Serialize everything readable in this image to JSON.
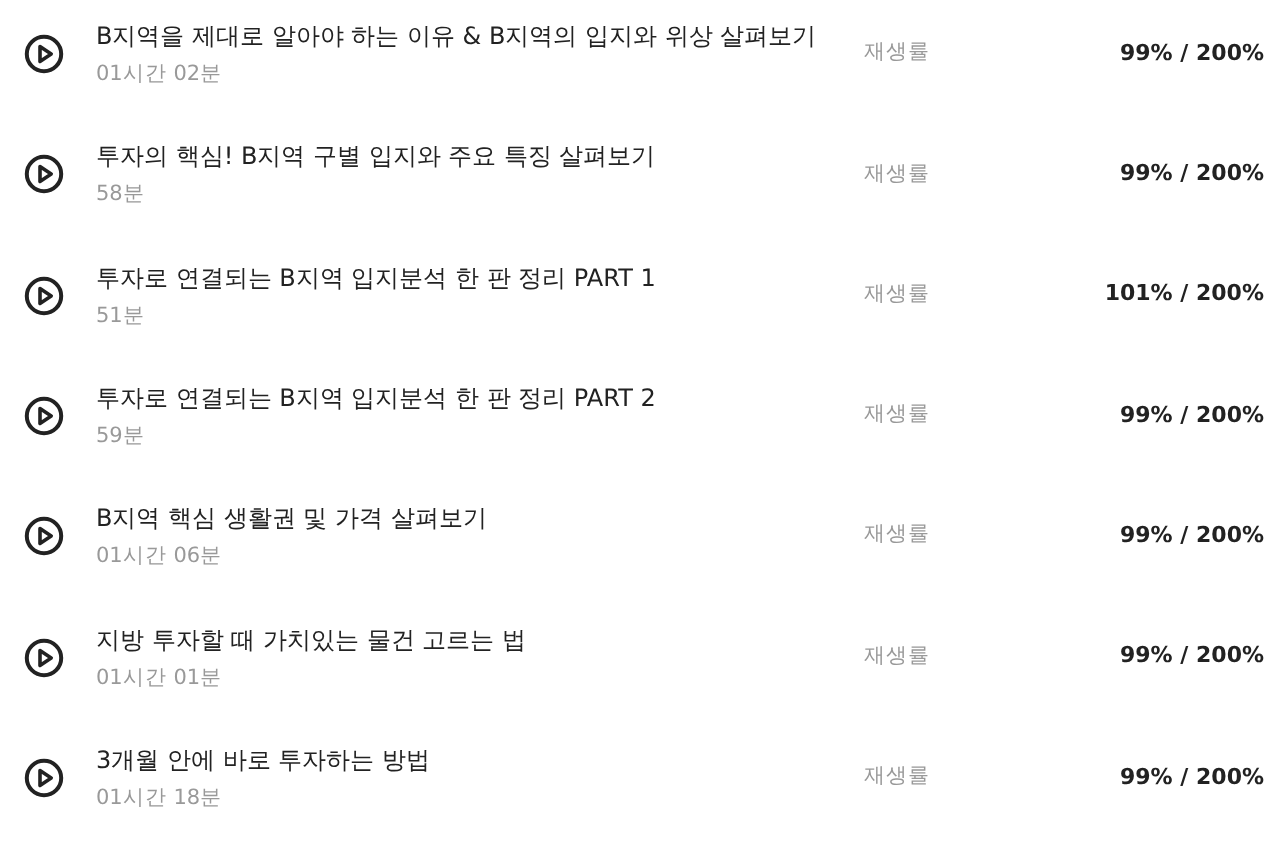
{
  "lessons": [
    {
      "title": "B지역을 제대로 알아야 하는 이유 & B지역의 입지와 위상 살펴보기",
      "duration": "01시간 02분",
      "rate_label": "재생률",
      "rate": "99% / 200%"
    },
    {
      "title": "투자의 핵심! B지역 구별 입지와 주요 특징 살펴보기",
      "duration": "58분",
      "rate_label": "재생률",
      "rate": "99% / 200%"
    },
    {
      "title": "투자로 연결되는 B지역 입지분석 한 판 정리 PART 1",
      "duration": "51분",
      "rate_label": "재생률",
      "rate": "101% / 200%"
    },
    {
      "title": "투자로 연결되는 B지역 입지분석 한 판 정리 PART 2",
      "duration": "59분",
      "rate_label": "재생률",
      "rate": "99% / 200%"
    },
    {
      "title": "B지역 핵심 생활권 및 가격 살펴보기",
      "duration": "01시간 06분",
      "rate_label": "재생률",
      "rate": "99% / 200%"
    },
    {
      "title": "지방 투자할 때 가치있는 물건 고르는 법",
      "duration": "01시간 01분",
      "rate_label": "재생률",
      "rate": "99% / 200%"
    },
    {
      "title": "3개월 안에 바로 투자하는 방법",
      "duration": "01시간 18분",
      "rate_label": "재생률",
      "rate": "99% / 200%"
    }
  ]
}
